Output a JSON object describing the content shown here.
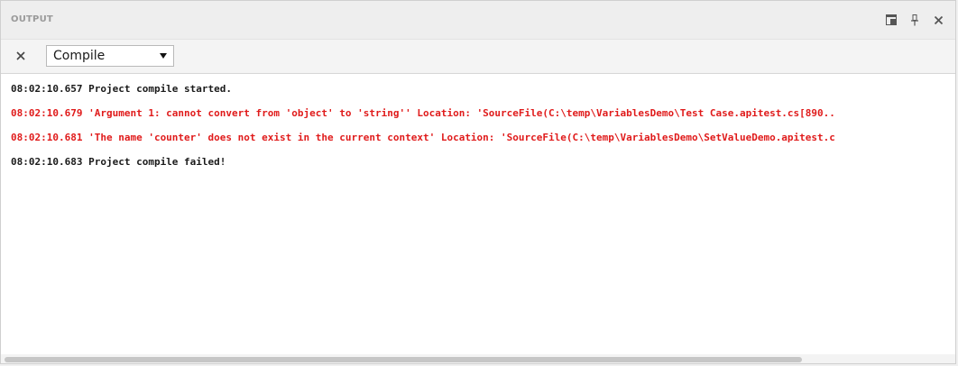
{
  "panel": {
    "title": "OUTPUT"
  },
  "title_actions": [
    {
      "icon": "float-window-icon"
    },
    {
      "icon": "pin-icon"
    },
    {
      "icon": "close-icon"
    }
  ],
  "toolbar": {
    "clear_icon": "clear-icon",
    "source_select": {
      "selected": "Compile"
    }
  },
  "output": {
    "lines": [
      {
        "text": "08:02:10.657 Project compile started.",
        "level": "info"
      },
      {
        "text": "08:02:10.679 'Argument 1: cannot convert from 'object' to 'string'' Location: 'SourceFile(C:\\temp\\VariablesDemo\\Test Case.apitest.cs[890..",
        "level": "error"
      },
      {
        "text": "08:02:10.681 'The name 'counter' does not exist in the current context' Location: 'SourceFile(C:\\temp\\VariablesDemo\\SetValueDemo.apitest.c",
        "level": "error"
      },
      {
        "text": "08:02:10.683 Project compile failed!",
        "level": "info"
      }
    ]
  },
  "colors": {
    "info": "#1a1a1a",
    "error": "#e01b1b",
    "title": "#9a9a9a"
  }
}
